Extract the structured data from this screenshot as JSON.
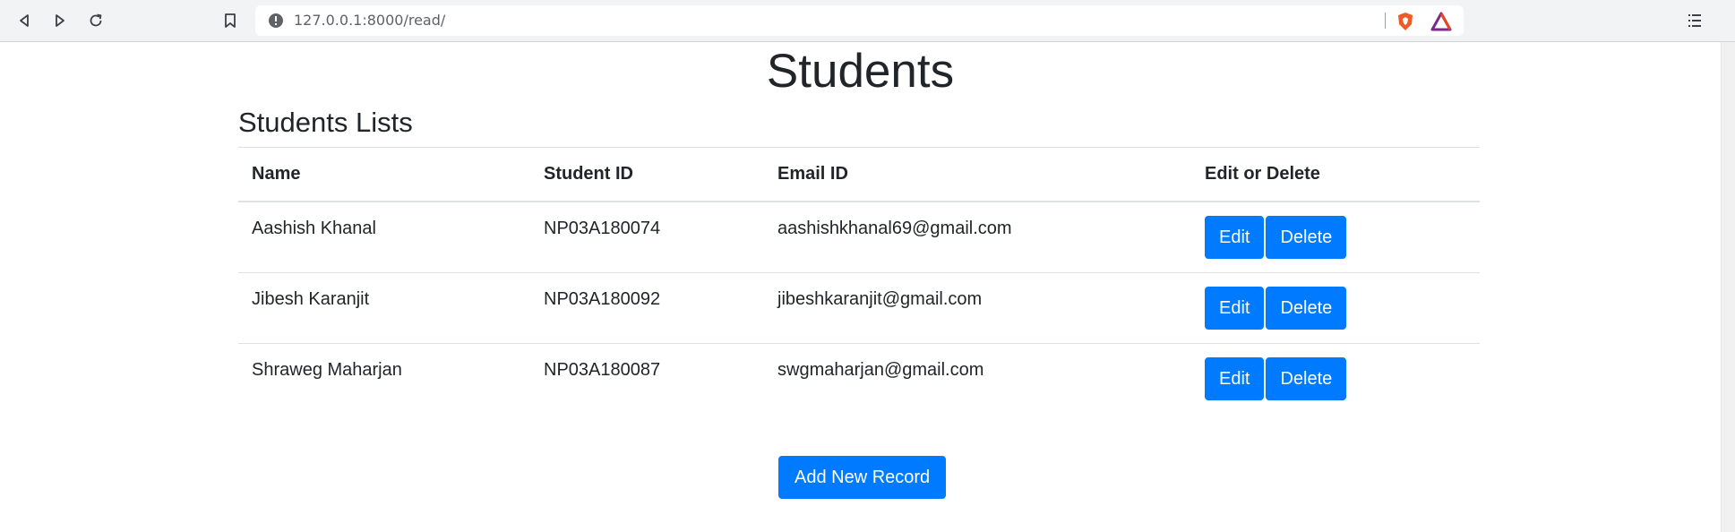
{
  "browser": {
    "url": "127.0.0.1:8000/read/",
    "icons": [
      "back-icon",
      "forward-icon",
      "reload-icon",
      "bookmark-icon",
      "site-info-icon",
      "brave-shield-icon",
      "brave-rewards-icon",
      "menu-icon"
    ]
  },
  "page": {
    "title": "Students",
    "subtitle": "Students Lists"
  },
  "table": {
    "headers": {
      "name": "Name",
      "student_id": "Student ID",
      "email": "Email ID",
      "actions": "Edit or Delete"
    },
    "rows": [
      {
        "name": "Aashish Khanal",
        "student_id": "NP03A180074",
        "email": "aashishkhanal69@gmail.com",
        "edit": "Edit",
        "delete": "Delete"
      },
      {
        "name": "Jibesh Karanjit",
        "student_id": "NP03A180092",
        "email": "jibeshkaranjit@gmail.com",
        "edit": "Edit",
        "delete": "Delete"
      },
      {
        "name": "Shraweg Maharjan",
        "student_id": "NP03A180087",
        "email": "swgmaharjan@gmail.com",
        "edit": "Edit",
        "delete": "Delete"
      }
    ]
  },
  "actions": {
    "add_label": "Add New Record"
  },
  "colors": {
    "primary": "#007bff",
    "text": "#212529",
    "border": "#dee2e6",
    "chrome": "#f1f3f4"
  }
}
